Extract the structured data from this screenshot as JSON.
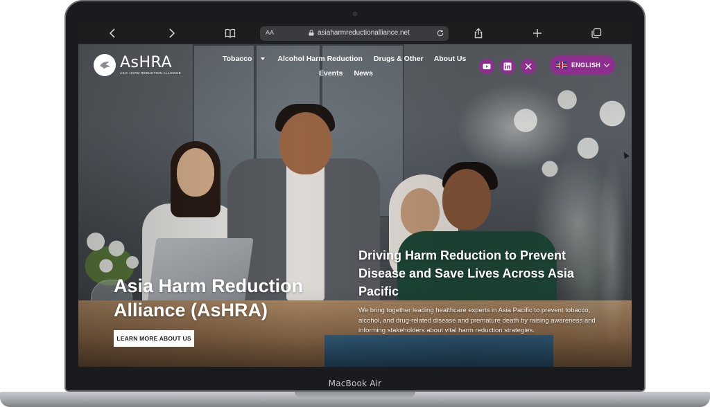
{
  "device": {
    "brand_label": "MacBook Air"
  },
  "browser": {
    "text_size_button": "AA",
    "url": "asiaharmreductionalliance.net",
    "icons": [
      "back-icon",
      "forward-icon",
      "book-icon",
      "lock-icon",
      "reload-icon",
      "share-icon",
      "plus-icon",
      "tabs-icon"
    ]
  },
  "site": {
    "logo": {
      "name": "AsHRA",
      "subtitle": "ASIA HARM REDUCTION ALLIANCE"
    },
    "nav": {
      "row1": [
        {
          "label": "Tobacco",
          "has_dropdown": true
        },
        {
          "label": "Alcohol Harm Reduction",
          "has_dropdown": false
        },
        {
          "label": "Drugs & Other",
          "has_dropdown": false
        },
        {
          "label": "About Us",
          "has_dropdown": false
        }
      ],
      "row2": [
        {
          "label": "Events",
          "has_dropdown": false
        },
        {
          "label": "News",
          "has_dropdown": false
        }
      ]
    },
    "social": [
      "youtube-icon",
      "linkedin-icon",
      "x-icon"
    ],
    "language": "ENGLISH",
    "colors": {
      "accent": "#8e2f8f",
      "text_on_hero": "#ffffff"
    }
  },
  "hero": {
    "title": "Asia Harm Reduction Alliance (AsHRA)",
    "cta_label": "LEARN MORE ABOUT US",
    "tagline": "Driving Harm Reduction to Prevent Disease and Save Lives Across Asia Pacific",
    "description": "We bring together leading healthcare experts in Asia Pacific to prevent tobacco, alcohol, and drug-related disease and premature death by raising awareness and informing stakeholders about vital harm reduction strategies."
  }
}
